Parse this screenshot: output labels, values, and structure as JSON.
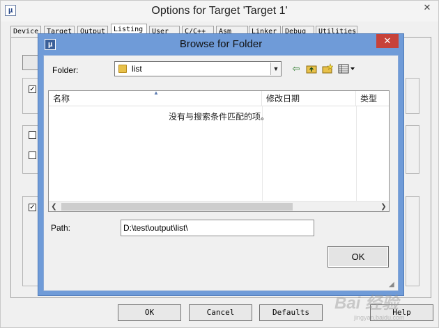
{
  "colors": {
    "dialog_frame": "#6f9bd8",
    "close_button": "#c7423a",
    "window_bg": "#f0f0f0"
  },
  "background_window": {
    "title": "Options for Target 'Target 1'",
    "close_glyph": "✕",
    "tabs": [
      "Device",
      "Target",
      "Output",
      "Listing",
      "User",
      "C/C++",
      "Asm",
      "Linker",
      "Debug",
      "Utilities"
    ],
    "active_tab": "Listing",
    "buttons": {
      "ok": "OK",
      "cancel": "Cancel",
      "defaults": "Defaults",
      "help": "Help"
    }
  },
  "browse_dialog": {
    "title": "Browse for Folder",
    "close_glyph": "✕",
    "folder_label": "Folder:",
    "folder_value": "list",
    "toolbar_icons": [
      "back-arrow-icon",
      "up-folder-icon",
      "new-folder-icon",
      "view-menu-icon"
    ],
    "list": {
      "columns": [
        "名称",
        "修改日期",
        "类型"
      ],
      "empty_message": "没有与搜索条件匹配的项。"
    },
    "path_label": "Path:",
    "path_value": "D:\\test\\output\\list\\",
    "ok_label": "OK"
  },
  "watermark": {
    "text": "Bai 经验",
    "sub": "jingyan.baidu.com"
  }
}
